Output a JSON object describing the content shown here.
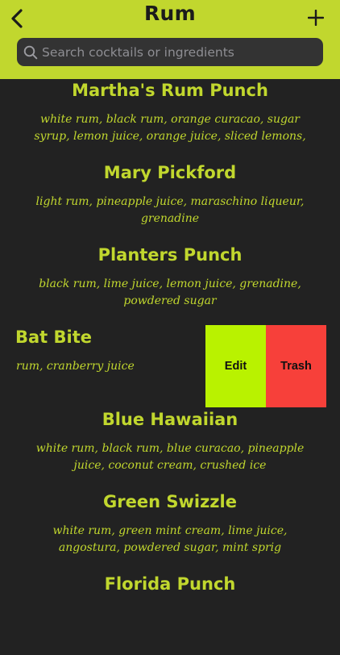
{
  "header": {
    "title": "Rum",
    "back_icon": "chevron-left-icon",
    "add_icon": "plus-icon"
  },
  "search": {
    "placeholder": "Search cocktails or ingredients",
    "value": "",
    "icon": "search-icon"
  },
  "cocktails": [
    {
      "name": "Martha's Rum Punch",
      "ingredients": "white rum, black rum, orange curacao, sugar syrup, lemon juice, orange juice, sliced lemons,"
    },
    {
      "name": "Mary Pickford",
      "ingredients": "light rum, pineapple juice, maraschino liqueur, grenadine"
    },
    {
      "name": "Planters Punch",
      "ingredients": "black rum, lime juice, lemon juice, grenadine, powdered sugar"
    },
    {
      "name": "Bat Bite",
      "ingredients": "rum, cranberry juice"
    },
    {
      "name": "Blue Hawaiian",
      "ingredients": "white rum, black rum, blue curacao, pineapple juice, coconut cream, crushed ice"
    },
    {
      "name": "Green Swizzle",
      "ingredients": "white rum, green mint cream, lime juice, angostura, powdered sugar, mint sprig"
    },
    {
      "name": "Florida Punch",
      "ingredients": ""
    }
  ],
  "swipe_actions": {
    "edit_label": "Edit",
    "trash_label": "Trash"
  },
  "colors": {
    "accent": "#c1d72e",
    "background": "#222222",
    "edit": "#b9f200",
    "trash": "#f7403a"
  }
}
